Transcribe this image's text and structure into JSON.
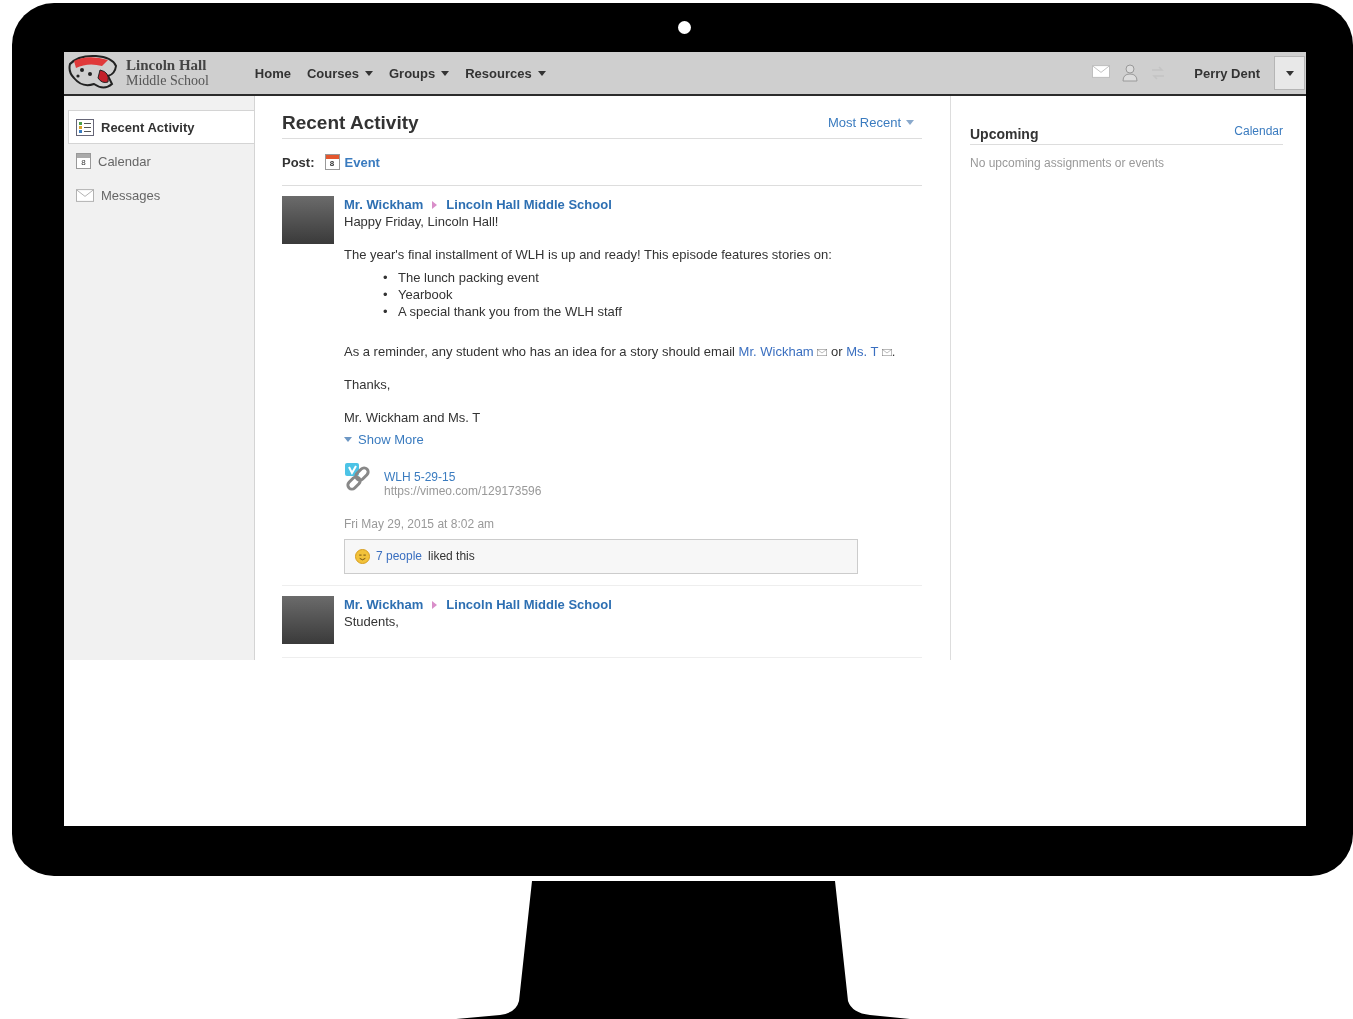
{
  "school": {
    "name": "Lincoln Hall",
    "subtitle": "Middle School"
  },
  "nav": [
    {
      "label": "Home",
      "dropdown": false
    },
    {
      "label": "Courses",
      "dropdown": true
    },
    {
      "label": "Groups",
      "dropdown": true
    },
    {
      "label": "Resources",
      "dropdown": true
    }
  ],
  "user": {
    "name": "Perry Dent"
  },
  "sidebar": [
    {
      "label": "Recent Activity",
      "kind": "activity",
      "selected": true
    },
    {
      "label": "Calendar",
      "kind": "calendar",
      "day": "8",
      "selected": false
    },
    {
      "label": "Messages",
      "kind": "messages",
      "selected": false
    }
  ],
  "feed": {
    "title": "Recent Activity",
    "sort": "Most Recent",
    "post_label": "Post:",
    "post_option": {
      "label": "Event",
      "day": "8"
    }
  },
  "posts": [
    {
      "author": "Mr. Wickham",
      "target": "Lincoln Hall Middle School",
      "body": [
        {
          "kind": "text",
          "text": "Happy Friday, Lincoln Hall!"
        },
        {
          "kind": "text",
          "text": "The year's final installment of WLH is up and ready! This episode features stories on:"
        },
        {
          "kind": "list",
          "marker": "•",
          "items": [
            "The lunch packing event",
            "Yearbook",
            "A special thank you from the WLH staff"
          ]
        },
        {
          "kind": "mention",
          "before": "As a reminder, any student who has an idea for a story should email",
          "links": [
            "Mr. Wickham",
            "Ms. T"
          ],
          "joiner": "or",
          "after": "."
        },
        {
          "kind": "text",
          "text": "Thanks,"
        },
        {
          "kind": "text",
          "text": "Mr. Wickham and Ms. T"
        }
      ],
      "show_more": "Show More",
      "link": {
        "title": "WLH 5-29-15",
        "url": "https://vimeo.com/129173596"
      },
      "timestamp": "Fri May 29, 2015 at 8:02 am",
      "likes": {
        "count": "7 people",
        "rest": "liked this"
      }
    },
    {
      "author": "Mr. Wickham",
      "target": "Lincoln Hall Middle School",
      "body": [
        {
          "kind": "text",
          "text": "Students,"
        }
      ]
    }
  ],
  "upcoming": {
    "title": "Upcoming",
    "link": "Calendar",
    "empty": "No upcoming assignments or events"
  }
}
